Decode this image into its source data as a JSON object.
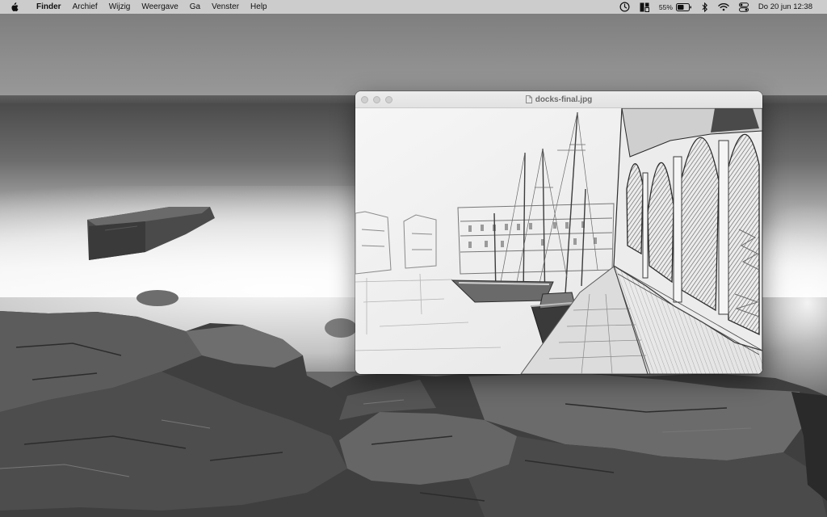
{
  "menubar": {
    "app_name": "Finder",
    "menus": [
      "Archief",
      "Wijzig",
      "Weergave",
      "Ga",
      "Venster",
      "Help"
    ],
    "status": {
      "battery_percent": "55%",
      "datetime": "Do 20 jun  12:38"
    }
  },
  "icons": {
    "apple": "apple-logo-icon",
    "clock": "clock-icon",
    "layout": "window-layout-icon",
    "battery": "battery-icon",
    "bluetooth": "bluetooth-icon",
    "wifi": "wifi-icon",
    "control_center": "control-center-icon",
    "file": "image-file-icon"
  },
  "window": {
    "title": "docks-final.jpg",
    "image_description_kind": "pencil sketch of sailing ships at a dock"
  }
}
